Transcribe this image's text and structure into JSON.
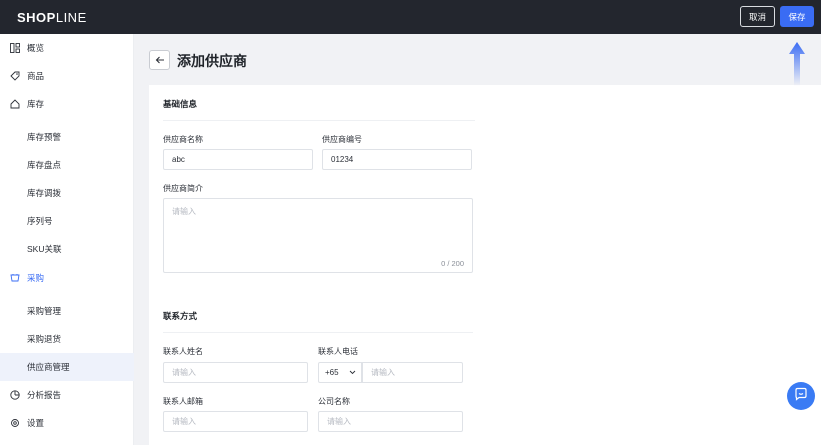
{
  "topbar": {
    "logo_bold": "SHOP",
    "logo_light": "LINE",
    "cancel_label": "取消",
    "save_label": "保存"
  },
  "sidebar": {
    "items": [
      {
        "label": "概览",
        "icon": "grid-icon"
      },
      {
        "label": "商品",
        "icon": "tag-icon"
      },
      {
        "label": "库存",
        "icon": "home-icon"
      },
      {
        "label": "库存预警"
      },
      {
        "label": "库存盘点"
      },
      {
        "label": "库存调拨"
      },
      {
        "label": "序列号"
      },
      {
        "label": "SKU关联"
      },
      {
        "label": "采购",
        "icon": "basket-icon"
      },
      {
        "label": "采购管理"
      },
      {
        "label": "采购退货"
      },
      {
        "label": "供应商管理"
      },
      {
        "label": "分析报告",
        "icon": "pie-chart-icon"
      },
      {
        "label": "设置",
        "icon": "gear-icon"
      }
    ]
  },
  "page": {
    "title": "添加供应商"
  },
  "basic_info": {
    "title": "基础信息",
    "name_label": "供应商名称",
    "name_value": "abc",
    "code_label": "供应商编号",
    "code_value": "01234",
    "intro_label": "供应商简介",
    "intro_placeholder": "请输入",
    "intro_counter": "0 / 200"
  },
  "contact": {
    "title": "联系方式",
    "person_label": "联系人姓名",
    "person_placeholder": "请输入",
    "phone_label": "联系人电话",
    "phone_code": "+65",
    "phone_placeholder": "请输入",
    "email_label": "联系人邮箱",
    "email_placeholder": "请输入",
    "company_label": "公司名称",
    "company_placeholder": "请输入"
  },
  "colors": {
    "accent": "#3a6cf4",
    "topbar": "#23262e"
  }
}
